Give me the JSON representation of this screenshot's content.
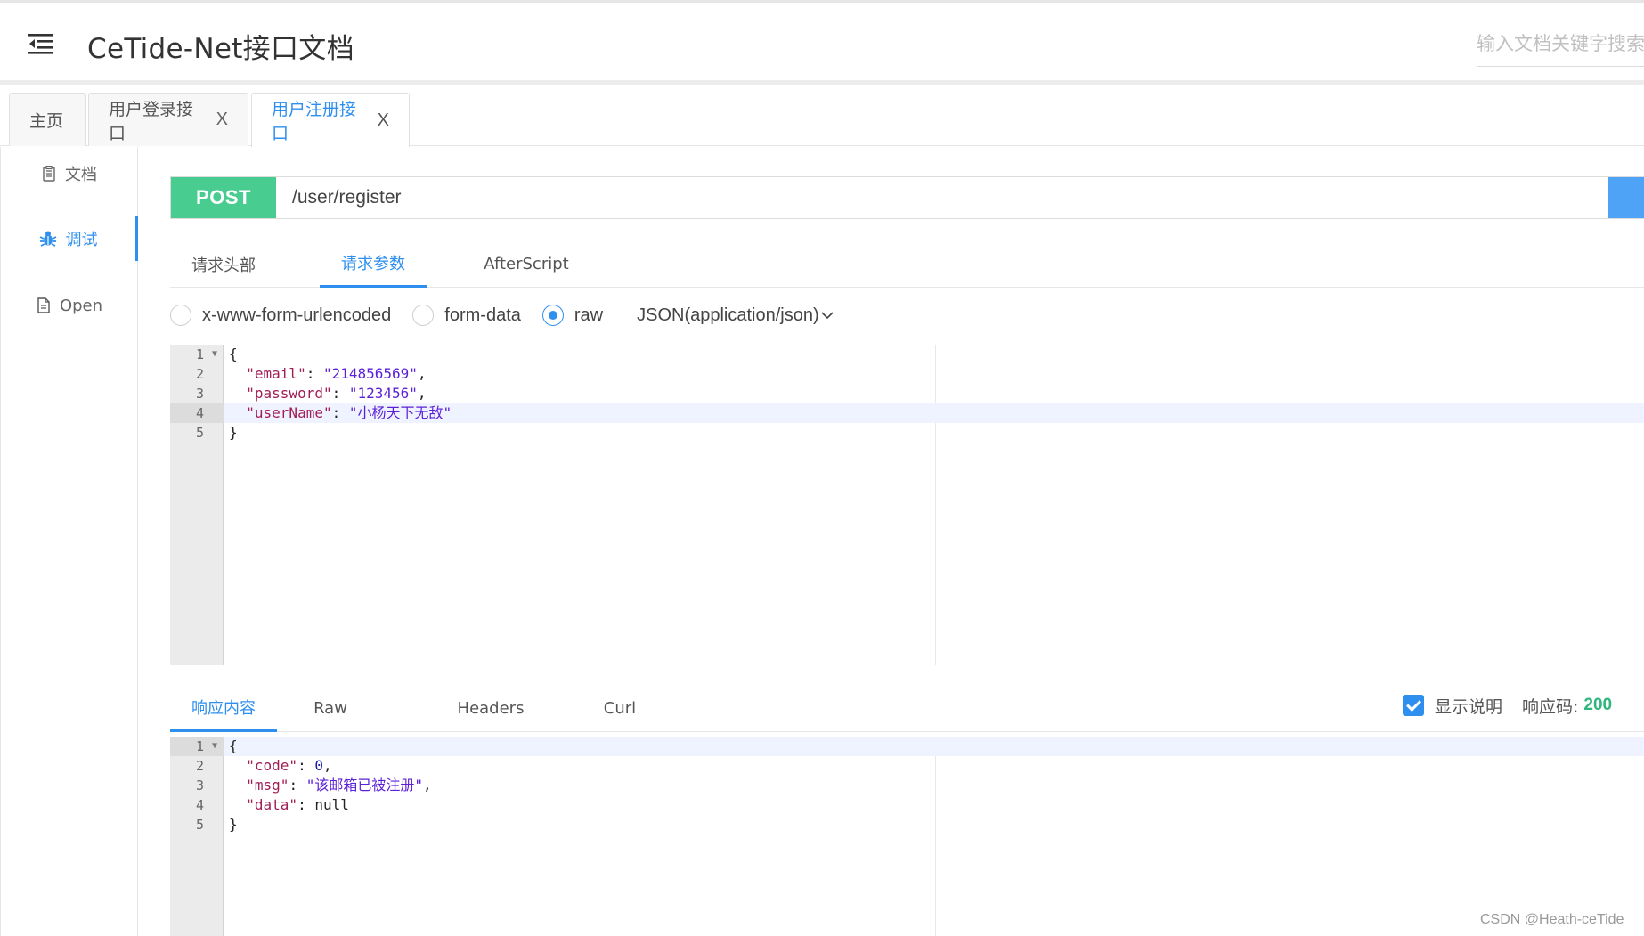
{
  "header": {
    "title": "CeTide-Net接口文档",
    "search_placeholder": "输入文档关键字搜索"
  },
  "tabs": [
    {
      "label": "主页",
      "closable": false,
      "active": false
    },
    {
      "label": "用户登录接口",
      "closable": true,
      "active": false
    },
    {
      "label": "用户注册接口",
      "closable": true,
      "active": true
    }
  ],
  "tab_close_glyph": "X",
  "sidebar": {
    "items": [
      {
        "label": "文档",
        "icon": "document-icon",
        "active": false
      },
      {
        "label": "调试",
        "icon": "bug-icon",
        "active": true
      },
      {
        "label": "Open",
        "icon": "file-icon",
        "active": false
      }
    ]
  },
  "request": {
    "method": "POST",
    "method_color": "#49cc90",
    "url": "/user/register",
    "tabs": [
      "请求头部",
      "请求参数",
      "AfterScript"
    ],
    "active_tab": "请求参数",
    "body_types": [
      "x-www-form-urlencoded",
      "form-data",
      "raw"
    ],
    "selected_body_type": "raw",
    "content_type": "JSON(application/json)",
    "body_lines": [
      "1",
      "2",
      "3",
      "4",
      "5"
    ],
    "body": {
      "open": "{",
      "email_key": "\"email\"",
      "email_val": "\"214856569\"",
      "password_key": "\"password\"",
      "password_val": "\"123456\"",
      "username_key": "\"userName\"",
      "username_val": "\"小杨天下无敌\"",
      "close": "}"
    }
  },
  "response": {
    "tabs": [
      "响应内容",
      "Raw",
      "Headers",
      "Curl"
    ],
    "active_tab": "响应内容",
    "show_description_label": "显示说明",
    "show_description_checked": true,
    "status_label": "响应码:",
    "status_code": "200",
    "status_color": "#2fb57d",
    "body_lines": [
      "1",
      "2",
      "3",
      "4",
      "5"
    ],
    "body": {
      "open": "{",
      "code_key": "\"code\"",
      "code_val": "0",
      "msg_key": "\"msg\"",
      "msg_val": "\"该邮箱已被注册\"",
      "data_key": "\"data\"",
      "data_val": "null",
      "close": "}"
    }
  },
  "watermark": "CSDN @Heath-ceTide",
  "accent_color": "#2f8fef"
}
